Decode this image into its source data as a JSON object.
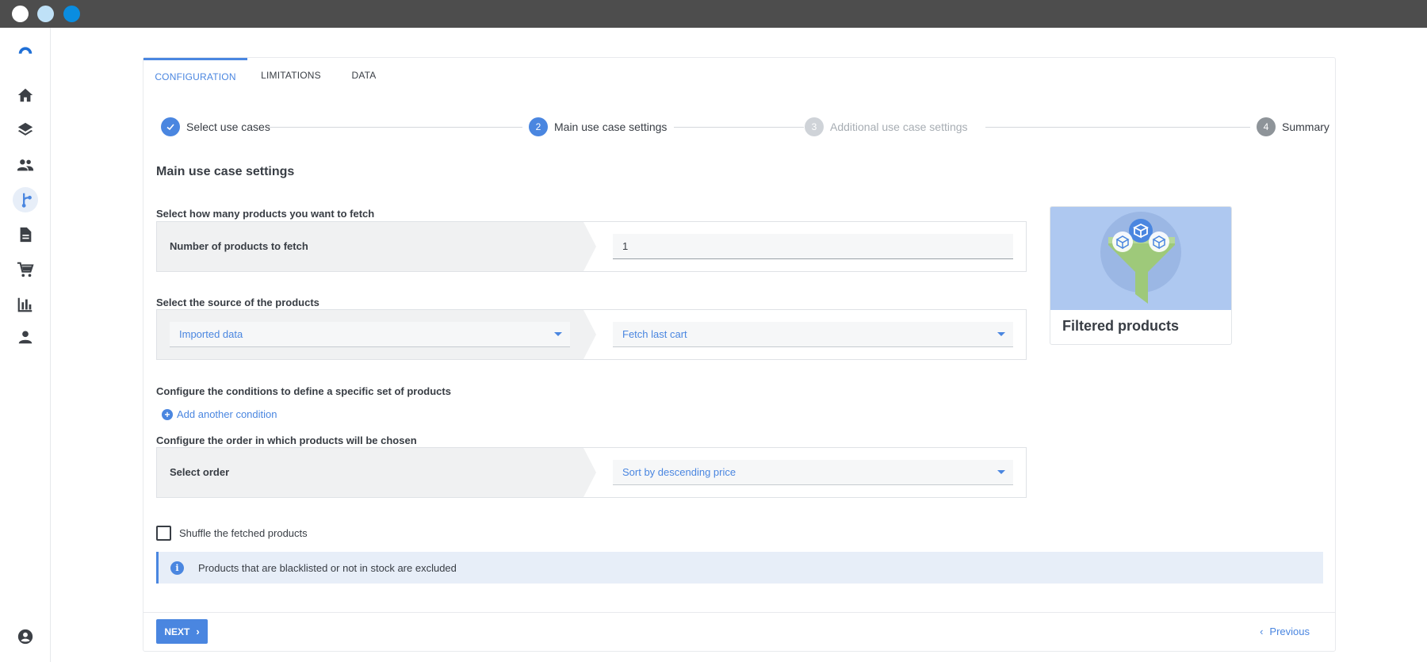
{
  "tabs": [
    {
      "label": "CONFIGURATION",
      "active": true
    },
    {
      "label": "LIMITATIONS",
      "active": false
    },
    {
      "label": "DATA",
      "active": false
    }
  ],
  "stepper": {
    "steps": [
      {
        "number": "",
        "label": "Select use cases",
        "state": "done"
      },
      {
        "number": "2",
        "label": "Main use case settings",
        "state": "current"
      },
      {
        "number": "3",
        "label": "Additional use case settings",
        "state": "pending"
      },
      {
        "number": "4",
        "label": "Summary",
        "state": "pending"
      }
    ]
  },
  "main": {
    "title": "Main use case settings",
    "fetch": {
      "label": "Select how many products you want to fetch",
      "row_label": "Number of products to fetch",
      "value": "1"
    },
    "source": {
      "label": "Select the source of the products",
      "source_value": "Imported data",
      "fetch_value": "Fetch last cart"
    },
    "conditions": {
      "label": "Configure the conditions to define a specific set of products",
      "add_label": "Add another condition"
    },
    "order": {
      "label": "Configure the order in which products will be chosen",
      "row_label": "Select order",
      "value": "Sort by descending price"
    },
    "shuffle_label": "Shuffle the fetched products",
    "shuffle_checked": false,
    "info_text": "Products that are blacklisted or not in stock are excluded"
  },
  "illustration": {
    "title": "Filtered products",
    "icon": "filter-funnel-icon"
  },
  "footer": {
    "next_label": "NEXT",
    "previous_label": "Previous"
  },
  "colors": {
    "accent": "#4a86e0",
    "titlebar": "#4d4d4d"
  },
  "sidebar": {
    "icons": [
      "logo-icon",
      "home-icon",
      "layers-icon",
      "people-icon",
      "flow-icon",
      "document-icon",
      "cart-icon",
      "chart-icon",
      "person-icon",
      "account-icon"
    ]
  }
}
